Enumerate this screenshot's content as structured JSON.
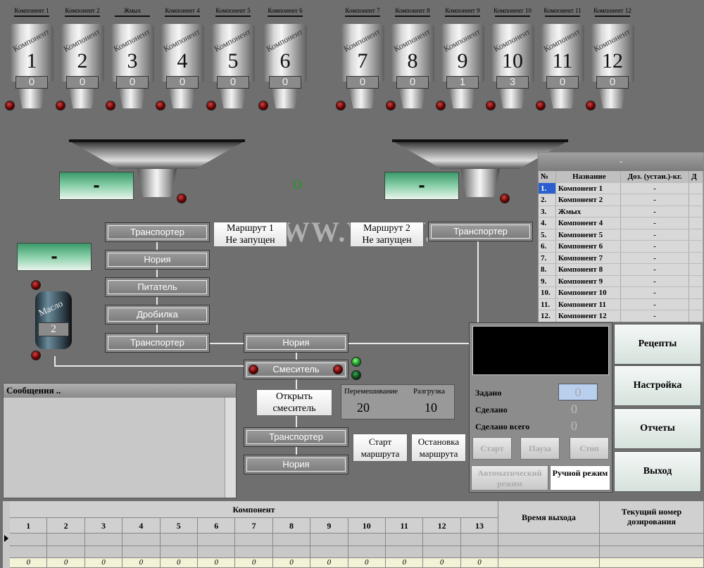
{
  "hoppers": [
    {
      "label": "Компонент 1",
      "number": "1",
      "count": "0",
      "diag": "Компонент"
    },
    {
      "label": "Компонент 2",
      "number": "2",
      "count": "0",
      "diag": "Компонент"
    },
    {
      "label": "Жмых",
      "number": "3",
      "count": "0",
      "diag": "Компонент"
    },
    {
      "label": "Компонент 4",
      "number": "4",
      "count": "0",
      "diag": "Компонент"
    },
    {
      "label": "Компонент 5",
      "number": "5",
      "count": "0",
      "diag": "Компонент"
    },
    {
      "label": "Компонент 6",
      "number": "6",
      "count": "0",
      "diag": "Компонент"
    },
    {
      "label": "Компонент 7",
      "number": "7",
      "count": "0",
      "diag": "Компонент"
    },
    {
      "label": "Компонент 8",
      "number": "8",
      "count": "0",
      "diag": "Компонент"
    },
    {
      "label": "Компонент 9",
      "number": "9",
      "count": "1",
      "diag": "Компонент"
    },
    {
      "label": "Компонент 10",
      "number": "10",
      "count": "3",
      "diag": "Компонент"
    },
    {
      "label": "Компонент 11",
      "number": "11",
      "count": "0",
      "diag": "Компонент"
    },
    {
      "label": "Компонент 12",
      "number": "12",
      "count": "0",
      "diag": "Компонент"
    }
  ],
  "scales": {
    "left_value": "-",
    "right_value": "-",
    "oil_value": "-",
    "center_indicator": "O"
  },
  "oil_tank": {
    "label": "Масло",
    "count": "2"
  },
  "route1": {
    "title": "Маршрут 1",
    "status": "Не запущен"
  },
  "route2": {
    "title": "Маршрут 2",
    "status": "Не запущен"
  },
  "watermark": "WWW.VESY.KZ",
  "equipment": {
    "transporter1": "Транспортер",
    "noria1": "Нория",
    "feeder": "Питатель",
    "crusher": "Дробилка",
    "transporter2": "Транспортер",
    "transporter_right": "Транспортер",
    "noria_mid": "Нория",
    "mixer": "Смеситель",
    "transporter3": "Транспортер",
    "noria_bottom": "Нория"
  },
  "open_mixer_button": "Открыть смеситель",
  "mixing": {
    "mix_label": "Перемешивание",
    "mix_value": "20",
    "unload_label": "Разгрузка",
    "unload_value": "10"
  },
  "route_buttons": {
    "start": "Старт маршрута",
    "stop": "Остановка маршрута"
  },
  "messages_title": "Сообщения ..",
  "recipe_table": {
    "header": "-",
    "columns": [
      "№",
      "Название",
      "Доз. (устан.)-кг.",
      "Д"
    ],
    "rows": [
      {
        "n": "1.",
        "name": "Компонент 1",
        "dose": "-"
      },
      {
        "n": "2.",
        "name": "Компонент 2",
        "dose": "-"
      },
      {
        "n": "3.",
        "name": "Жмых",
        "dose": "-"
      },
      {
        "n": "4.",
        "name": "Компонент 4",
        "dose": "-"
      },
      {
        "n": "5.",
        "name": "Компонент 5",
        "dose": "-"
      },
      {
        "n": "6.",
        "name": "Компонент 6",
        "dose": "-"
      },
      {
        "n": "7.",
        "name": "Компонент 7",
        "dose": "-"
      },
      {
        "n": "8.",
        "name": "Компонент 8",
        "dose": "-"
      },
      {
        "n": "9.",
        "name": "Компонент 9",
        "dose": "-"
      },
      {
        "n": "10.",
        "name": "Компонент 10",
        "dose": "-"
      },
      {
        "n": "11.",
        "name": "Компонент 11",
        "dose": "-"
      },
      {
        "n": "12.",
        "name": "Компонент 12",
        "dose": "-"
      }
    ]
  },
  "control_panel": {
    "set_label": "Задано",
    "set_value": "0",
    "done_label": "Сделано",
    "done_value": "0",
    "done_total_label": "Сделано всего",
    "done_total_value": "0",
    "start": "Старт",
    "pause": "Пауза",
    "stop": "Стоп",
    "auto_mode": "Автоматический режим",
    "manual_mode": "Ручной режим"
  },
  "menu": {
    "recipes": "Рецепты",
    "settings": "Настройка",
    "reports": "Отчеты",
    "exit": "Выход"
  },
  "bottom_table": {
    "group_header": "Компонент",
    "columns": [
      "1",
      "2",
      "3",
      "4",
      "5",
      "6",
      "7",
      "8",
      "9",
      "10",
      "11",
      "12",
      "13"
    ],
    "exit_time": "Время выхода",
    "dose_number": "Текущий номер дозирования",
    "values": [
      "0",
      "0",
      "0",
      "0",
      "0",
      "0",
      "0",
      "0",
      "0",
      "0",
      "0",
      "0",
      "0"
    ]
  }
}
